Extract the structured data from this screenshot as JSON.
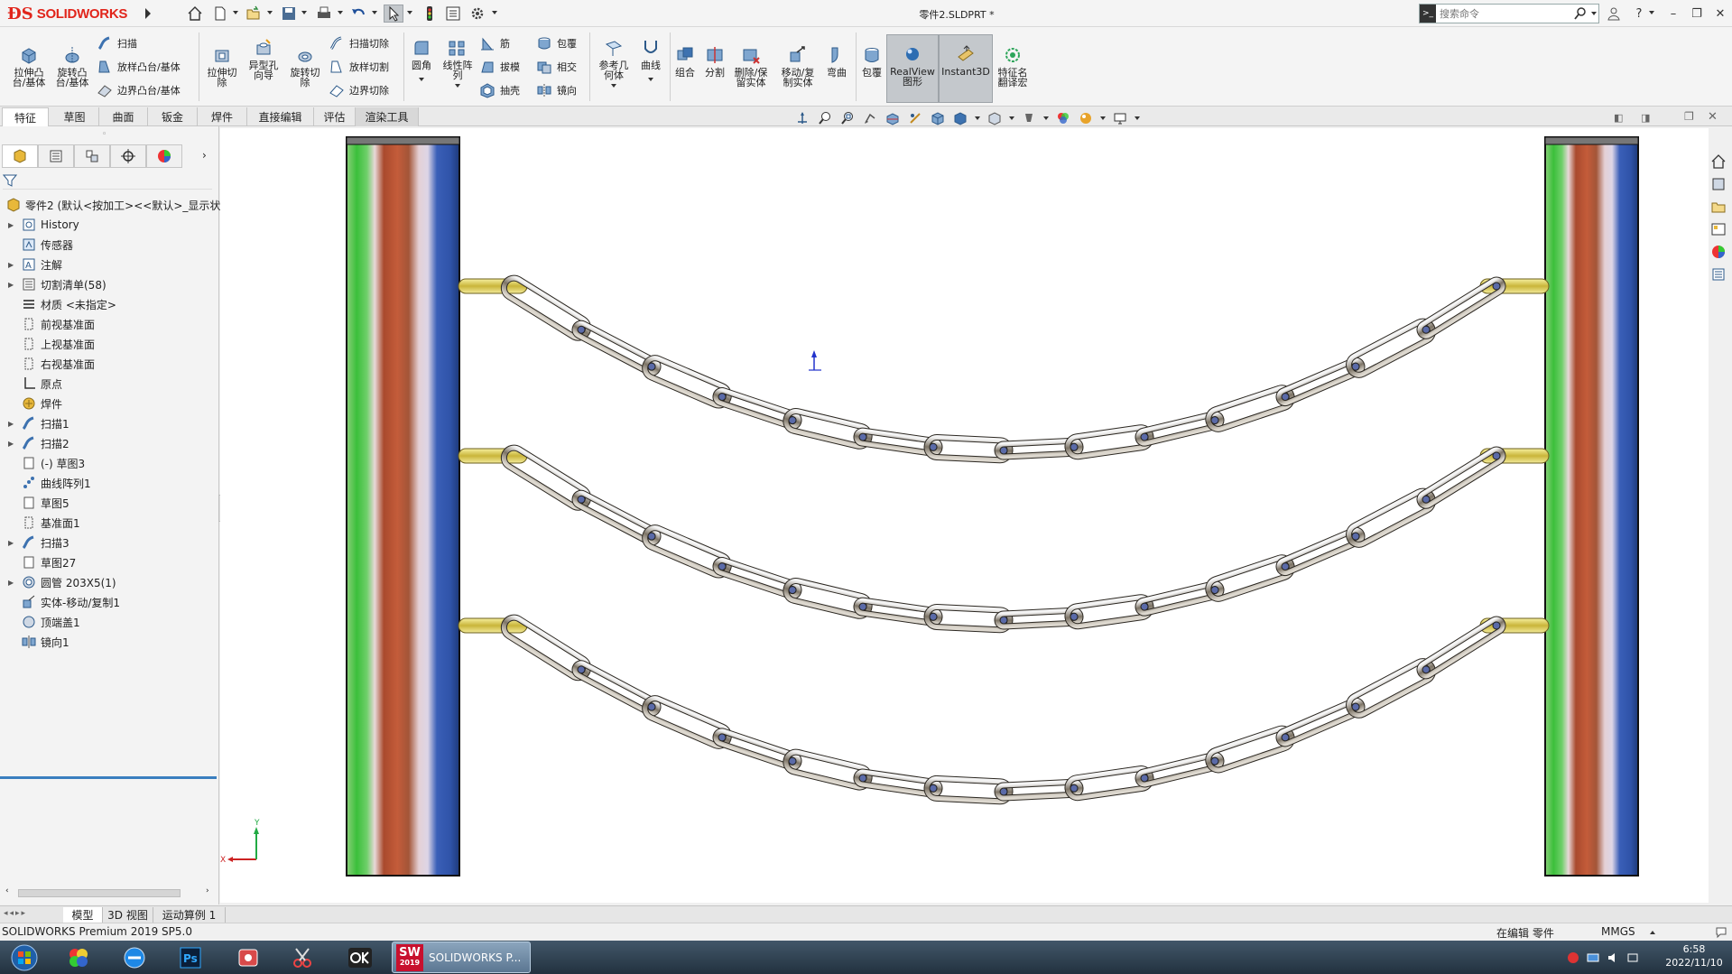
{
  "app": {
    "name": "SOLIDWORKS",
    "doc_title": "零件2.SLDPRT *"
  },
  "search": {
    "placeholder": "搜索命令"
  },
  "ribbon": {
    "extrude_boss": "拉伸凸\n台/基体",
    "revolve_boss": "旋转凸\n台/基体",
    "sweep": "扫描",
    "loft_boss": "放样凸台/基体",
    "boundary_boss": "边界凸台/基体",
    "extrude_cut": "拉伸切\n除",
    "hole_wizard": "异型孔\n向导",
    "revolve_cut": "旋转切\n除",
    "swept_cut": "扫描切除",
    "lofted_cut": "放样切割",
    "boundary_cut": "边界切除",
    "fillet": "圆角",
    "linear_pattern": "线性阵\n列",
    "rib": "筋",
    "draft": "拔模",
    "shell": "抽壳",
    "wrap": "包覆",
    "intersect": "相交",
    "mirror": "镜向",
    "ref_geometry": "参考几\n何体",
    "curves": "曲线",
    "combine": "组合",
    "split": "分割",
    "delete_keep_body": "删除/保\n留实体",
    "move_copy_body": "移动/复\n制实体",
    "flex": "弯曲",
    "wrap2": "包覆",
    "realview": "RealView\n图形",
    "instant3d": "Instant3D",
    "feature_translate": "特征名\n翻译宏"
  },
  "tabs": [
    "特征",
    "草图",
    "曲面",
    "钣金",
    "焊件",
    "直接编辑",
    "评估",
    "渲染工具"
  ],
  "tree": {
    "root": "零件2 (默认<按加工><<默认>_显示状",
    "items": [
      {
        "label": "History",
        "exp": true,
        "icon": "history-icon"
      },
      {
        "label": "传感器",
        "exp": false,
        "icon": "sensor-icon"
      },
      {
        "label": "注解",
        "exp": true,
        "icon": "annotation-icon"
      },
      {
        "label": "切割清单(58)",
        "exp": true,
        "icon": "cutlist-icon"
      },
      {
        "label": "材质 <未指定>",
        "exp": false,
        "icon": "material-icon"
      },
      {
        "label": "前视基准面",
        "exp": false,
        "icon": "plane-icon"
      },
      {
        "label": "上视基准面",
        "exp": false,
        "icon": "plane-icon"
      },
      {
        "label": "右视基准面",
        "exp": false,
        "icon": "plane-icon"
      },
      {
        "label": "原点",
        "exp": false,
        "icon": "origin-icon"
      },
      {
        "label": "焊件",
        "exp": false,
        "icon": "weldment-icon"
      },
      {
        "label": "扫描1",
        "exp": true,
        "icon": "sweep-icon"
      },
      {
        "label": "扫描2",
        "exp": true,
        "icon": "sweep-icon"
      },
      {
        "label": "(-) 草图3",
        "exp": false,
        "icon": "sketch-icon"
      },
      {
        "label": "曲线阵列1",
        "exp": false,
        "icon": "pattern-icon"
      },
      {
        "label": "草图5",
        "exp": false,
        "icon": "sketch-icon"
      },
      {
        "label": "基准面1",
        "exp": false,
        "icon": "plane-icon"
      },
      {
        "label": "扫描3",
        "exp": true,
        "icon": "sweep-icon"
      },
      {
        "label": "草图27",
        "exp": false,
        "icon": "sketch-icon"
      },
      {
        "label": "圆管 203X5(1)",
        "exp": true,
        "icon": "pipe-icon"
      },
      {
        "label": "实体-移动/复制1",
        "exp": false,
        "icon": "move-body-icon"
      },
      {
        "label": "顶端盖1",
        "exp": false,
        "icon": "endcap-icon"
      },
      {
        "label": "镜向1",
        "exp": false,
        "icon": "mirror-icon"
      }
    ]
  },
  "model_tabs": [
    "模型",
    "3D 视图",
    "运动算例 1"
  ],
  "status": {
    "version": "SOLIDWORKS Premium 2019 SP5.0",
    "editing": "在编辑 零件",
    "units": "MMGS"
  },
  "taskbar": {
    "sw_label": "SOLIDWORKS P...",
    "sw_badge": "2019",
    "time": "6:58",
    "date": "2022/11/10"
  },
  "axes": {
    "x": "X",
    "y": "Y"
  },
  "colors": {
    "accent": "#e1251b",
    "selection": "#3a7ebf"
  }
}
